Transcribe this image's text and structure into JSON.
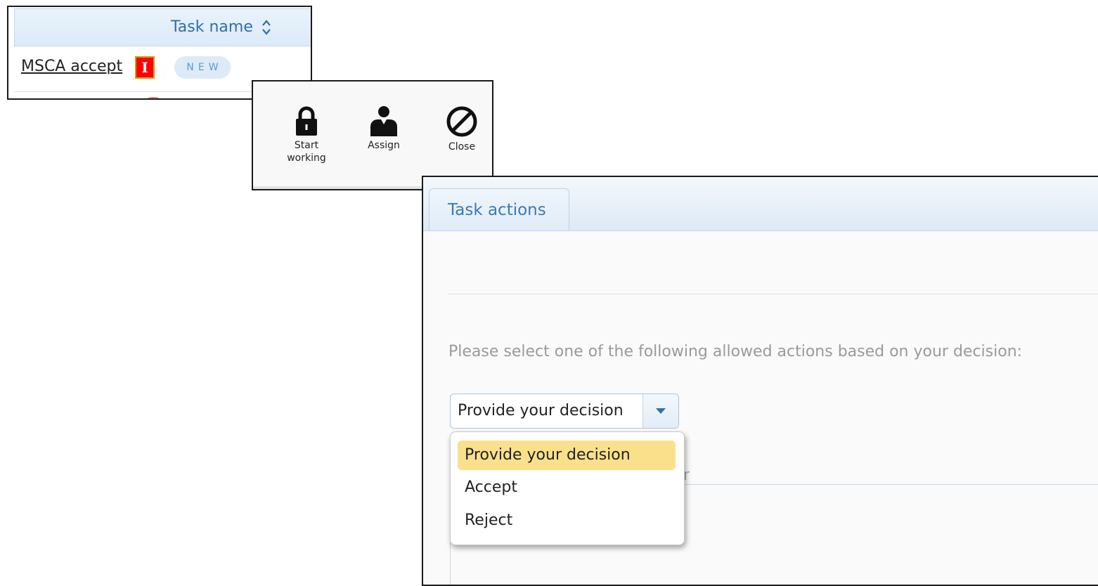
{
  "task_list": {
    "column_header": "Task name",
    "rows": [
      {
        "name": "MSCA accept",
        "badge": "I",
        "status": "NEW"
      }
    ]
  },
  "toolbar": {
    "actions": [
      {
        "label": "Start working",
        "icon": "lock-icon"
      },
      {
        "label": "Assign",
        "icon": "user-icon"
      },
      {
        "label": "Close",
        "icon": "prohibited-icon"
      }
    ]
  },
  "task_actions": {
    "tab_label": "Task actions",
    "instruction": "Please select one of the following allowed actions based on your decision:",
    "select": {
      "value": "Provide your decision",
      "options": [
        "Provide your decision",
        "Accept",
        "Reject"
      ],
      "highlighted_option": "Provide your decision"
    },
    "comment_label_fragment": "r"
  },
  "colors": {
    "accent": "#3b7ab5",
    "highlight": "#fbe08c",
    "badge_red": "#ff0000",
    "badge_new_bg": "#dcebf7"
  }
}
